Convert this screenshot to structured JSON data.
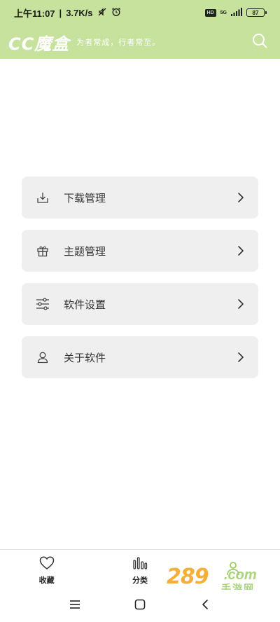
{
  "status_bar": {
    "time": "上午11:07",
    "speed": "3.7K/s",
    "network_badge": "HD",
    "network_type": "5G",
    "battery": "87"
  },
  "header": {
    "title": "CC魔盒",
    "slogan": "为者常成，行者常至。",
    "search_icon": "search-icon"
  },
  "menu": [
    {
      "label": "下载管理",
      "icon": "download-icon"
    },
    {
      "label": "主题管理",
      "icon": "gift-icon"
    },
    {
      "label": "软件设置",
      "icon": "sliders-icon"
    },
    {
      "label": "关于软件",
      "icon": "user-icon"
    }
  ],
  "tabs": [
    {
      "label": "收藏",
      "icon": "heart-icon"
    },
    {
      "label": "分类",
      "icon": "bar-chart-icon"
    },
    {
      "label": "",
      "icon": "person-icon"
    }
  ],
  "watermark": {
    "number": "289",
    "domain": ".com",
    "site_name": "手游网"
  },
  "colors": {
    "accent": "#c6e29c",
    "card_bg": "#efefef",
    "watermark_orange": "#f5a623",
    "watermark_green": "#9ccc65"
  }
}
